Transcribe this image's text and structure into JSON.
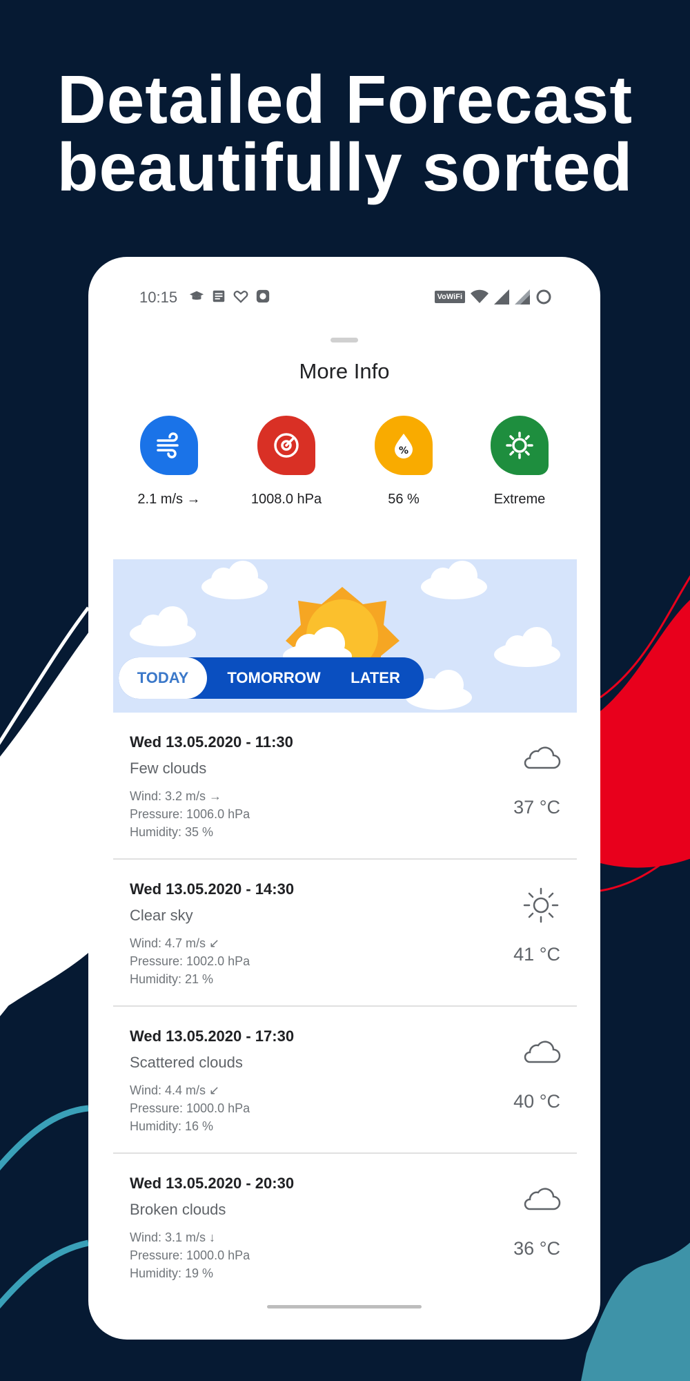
{
  "headline": {
    "line1": "Detailed Forecast",
    "line2": "beautifully sorted"
  },
  "status_bar": {
    "time": "10:15",
    "vowifi": "VoWiFi"
  },
  "sheet": {
    "title": "More Info"
  },
  "info": [
    {
      "label": "2.1 m/s →",
      "icon": "wind-icon",
      "color": "#1a73e8"
    },
    {
      "label": "1008.0 hPa",
      "icon": "pressure-gauge-icon",
      "color": "#d93025"
    },
    {
      "label": "56 %",
      "icon": "humidity-drop-icon",
      "color": "#f9ab00"
    },
    {
      "label": "Extreme",
      "icon": "uv-sun-icon",
      "color": "#1e8e3e"
    }
  ],
  "tabs": [
    {
      "label": "TODAY"
    },
    {
      "label": "TOMORROW"
    },
    {
      "label": "LATER"
    }
  ],
  "forecast": [
    {
      "date": "Wed 13.05.2020 - 11:30",
      "desc": "Few clouds",
      "wind": "Wind: 3.2 m/s →",
      "pressure": "Pressure: 1006.0 hPa",
      "humidity": "Humidity: 35 %",
      "temp": "37 °C",
      "icon": "cloud-icon"
    },
    {
      "date": "Wed 13.05.2020 - 14:30",
      "desc": "Clear sky",
      "wind": "Wind: 4.7 m/s ↙",
      "pressure": "Pressure: 1002.0 hPa",
      "humidity": "Humidity: 21 %",
      "temp": "41 °C",
      "icon": "sun-icon"
    },
    {
      "date": "Wed 13.05.2020 - 17:30",
      "desc": "Scattered clouds",
      "wind": "Wind: 4.4 m/s ↙",
      "pressure": "Pressure: 1000.0 hPa",
      "humidity": "Humidity: 16 %",
      "temp": "40 °C",
      "icon": "cloud-icon"
    },
    {
      "date": "Wed 13.05.2020 - 20:30",
      "desc": "Broken clouds",
      "wind": "Wind: 3.1 m/s ↓",
      "pressure": "Pressure: 1000.0 hPa",
      "humidity": "Humidity: 19 %",
      "temp": "36 °C",
      "icon": "cloud-icon"
    }
  ]
}
